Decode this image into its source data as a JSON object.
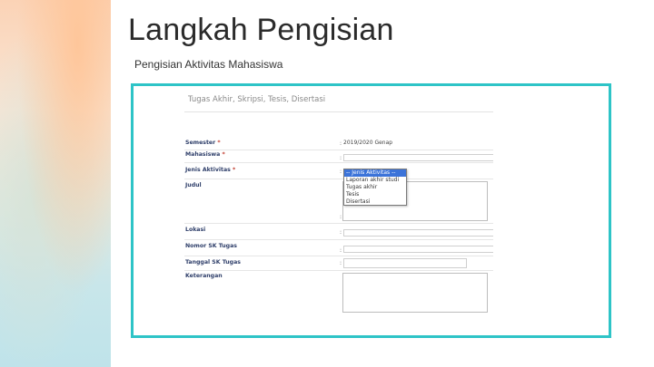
{
  "slide": {
    "title": "Langkah Pengisian",
    "subtitle": "Pengisian Aktivitas Mahasiswa"
  },
  "form": {
    "panel_title": "Tugas Akhir, Skripsi, Tesis, Disertasi",
    "fields": [
      {
        "label": "Semester",
        "required": "*",
        "value": "2019/2020 Genap"
      },
      {
        "label": "Mahasiswa",
        "required": "*",
        "value": ""
      },
      {
        "label": "Jenis Aktivitas",
        "required": "*",
        "value": "-- Jenis Aktivitas --"
      },
      {
        "label": "Judul",
        "required": "",
        "value": ""
      },
      {
        "label": "Lokasi",
        "required": "",
        "value": ""
      },
      {
        "label": "Nomor SK Tugas",
        "required": "",
        "value": ""
      },
      {
        "label": "Tanggal SK Tugas",
        "required": "",
        "value": ""
      },
      {
        "label": "Keterangan",
        "required": "",
        "value": ""
      }
    ],
    "colon": ":",
    "dropdown_options": [
      "-- Jenis Aktivitas --",
      "Laporan akhir studi",
      "Tugas akhir",
      "Tesis",
      "Disertasi"
    ]
  },
  "colors": {
    "frame_border": "#2ec4c7",
    "label_text": "#2f3f6a",
    "required_star": "#c0392b",
    "selected_option": "#3b73d9"
  }
}
